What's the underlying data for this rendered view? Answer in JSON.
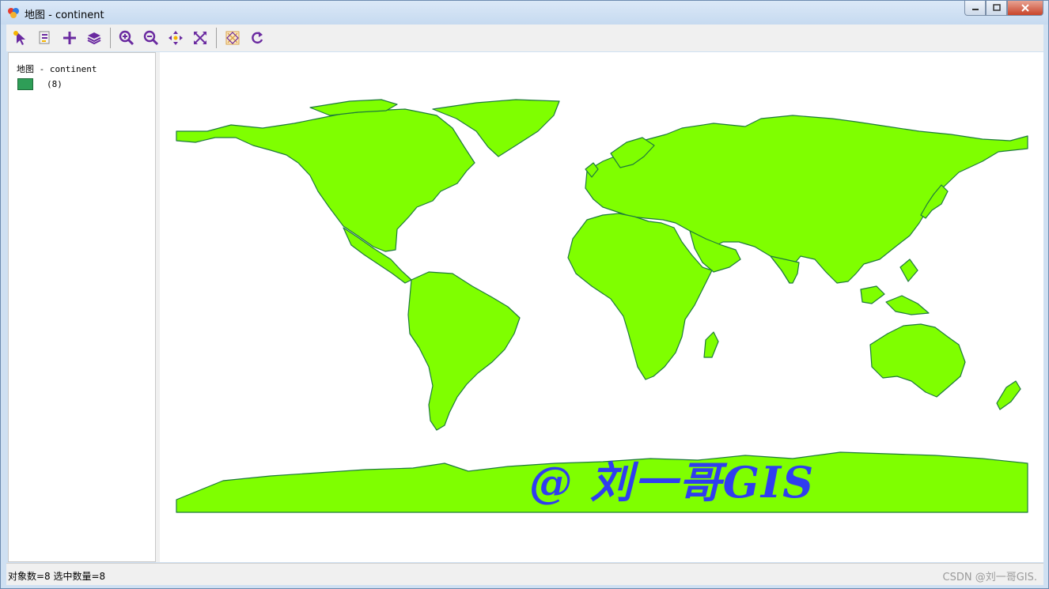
{
  "window": {
    "title": "地图 - continent"
  },
  "toolbar": {
    "buttons": [
      {
        "icon": "select-arrow-icon"
      },
      {
        "icon": "identify-icon"
      },
      {
        "icon": "add-plus-icon"
      },
      {
        "icon": "layers-icon"
      },
      {
        "icon": "zoom-in-icon"
      },
      {
        "icon": "zoom-out-icon"
      },
      {
        "icon": "pan-icon"
      },
      {
        "icon": "full-extent-icon"
      },
      {
        "icon": "clear-selection-icon"
      },
      {
        "icon": "refresh-icon"
      }
    ]
  },
  "legend": {
    "layer_title": "地图 - continent",
    "swatch_color": "#2e9e57",
    "count_label": "(8)"
  },
  "map": {
    "land_fill": "#7fff00",
    "land_stroke": "#1e7a3c"
  },
  "watermark": {
    "text": "@ 刘一哥GIS"
  },
  "status": {
    "text": "对象数=8 选中数量=8",
    "credit": "CSDN @刘一哥GIS."
  }
}
